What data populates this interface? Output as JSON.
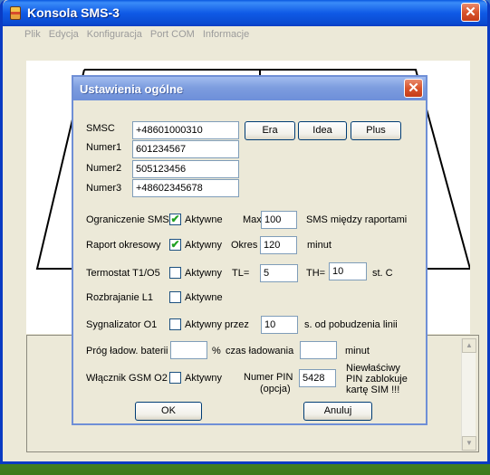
{
  "window": {
    "title": "Konsola SMS-3",
    "close_glyph": "✕",
    "menu": [
      "Plik",
      "Edycja",
      "Konfiguracja",
      "Port COM",
      "Informacje"
    ]
  },
  "dialog": {
    "title": "Ustawienia ogólne",
    "close_glyph": "✕",
    "smsc": {
      "label": "SMSC",
      "value": "+48601000310"
    },
    "numer1": {
      "label": "Numer1",
      "value": "601234567"
    },
    "numer2": {
      "label": "Numer2",
      "value": "505123456"
    },
    "numer3": {
      "label": "Numer3",
      "value": "+48602345678"
    },
    "operators": {
      "era": "Era",
      "idea": "Idea",
      "plus": "Plus"
    },
    "ograniczenie": {
      "label": "Ograniczenie SMS",
      "checked": true,
      "checkbox_label": "Aktywne",
      "max_label": "Max.",
      "max_value": "100",
      "suffix": "SMS między raportami"
    },
    "raport": {
      "label": "Raport okresowy",
      "checked": true,
      "checkbox_label": "Aktywny",
      "okres_label": "Okres",
      "okres_value": "120",
      "suffix": "minut"
    },
    "termostat": {
      "label": "Termostat T1/O5",
      "checked": false,
      "checkbox_label": "Aktywny",
      "tl_label": "TL=",
      "tl_value": "5",
      "th_label": "TH=",
      "th_value": "10",
      "unit": "st. C"
    },
    "rozbrajanie": {
      "label": "Rozbrajanie L1",
      "checked": false,
      "checkbox_label": "Aktywne"
    },
    "sygnalizator": {
      "label": "Sygnalizator O1",
      "checked": false,
      "checkbox_label": "Aktywny przez",
      "value": "10",
      "suffix": "s. od pobudzenia linii"
    },
    "prog": {
      "label": "Próg ładow. baterii",
      "value": "",
      "percent": "%",
      "czas_label": "czas ładowania",
      "czas_value": "",
      "suffix": "minut"
    },
    "wlacznik": {
      "label": "Włącznik GSM O2",
      "checked": false,
      "checkbox_label": "Aktywny",
      "pin_label_1": "Numer PIN",
      "pin_label_2": "(opcja)",
      "pin_value": "5428",
      "warning_1": "Niewłaściwy",
      "warning_2": "PIN zablokuje",
      "warning_3": "kartę SIM !!!"
    },
    "ok_label": "OK",
    "cancel_label": "Anuluj"
  },
  "scrollbar": {
    "up_glyph": "▲",
    "down_glyph": "▼"
  },
  "colors": {
    "titlebar": "#0a58e0",
    "dialog_title": "#7d9ddf",
    "check": "#21a121",
    "close": "#d9542c"
  }
}
